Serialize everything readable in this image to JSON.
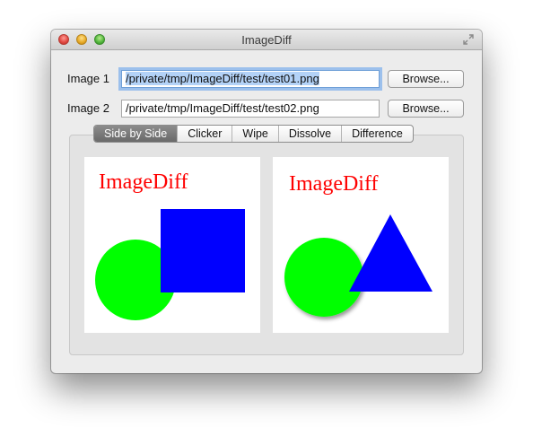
{
  "window": {
    "title": "ImageDiff"
  },
  "form": {
    "image1_label": "Image 1",
    "image1_value": "/private/tmp/ImageDiff/test/test01.png",
    "image2_label": "Image 2",
    "image2_value": "/private/tmp/ImageDiff/test/test02.png",
    "browse_label": "Browse..."
  },
  "tabs": [
    "Side by Side",
    "Clicker",
    "Wipe",
    "Dissolve",
    "Difference"
  ],
  "selected_tab": "Side by Side",
  "images": {
    "left_text": "ImageDiff",
    "right_text": "ImageDiff"
  },
  "colors": {
    "text_red": "#ff0000",
    "circle_green": "#00ff00",
    "shape_blue": "#0000ff"
  }
}
